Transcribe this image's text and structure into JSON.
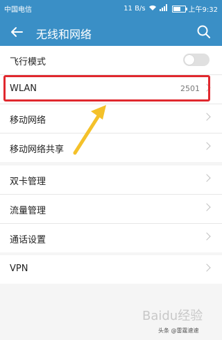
{
  "status_bar": {
    "carrier": "中国电信",
    "speed": "11 B/s",
    "time": "上午9:32"
  },
  "header": {
    "title": "无线和网络"
  },
  "groups": [
    {
      "items": [
        {
          "label": "飞行模式",
          "type": "toggle",
          "toggle_state": "off"
        },
        {
          "label": "WLAN",
          "type": "link",
          "value": "2501"
        },
        {
          "label": "移动网络",
          "type": "link"
        },
        {
          "label": "移动网络共享",
          "type": "link"
        }
      ]
    },
    {
      "items": [
        {
          "label": "双卡管理",
          "type": "link"
        },
        {
          "label": "流量管理",
          "type": "link"
        },
        {
          "label": "通话设置",
          "type": "link"
        }
      ]
    },
    {
      "items": [
        {
          "label": "VPN",
          "type": "link"
        }
      ]
    }
  ],
  "watermark": {
    "text": "Baidu经验",
    "sub": "头条 @雷霆速速"
  },
  "colors": {
    "header": "#3a8fc6",
    "highlight": "#e0282e",
    "arrow": "#f4c12a"
  }
}
